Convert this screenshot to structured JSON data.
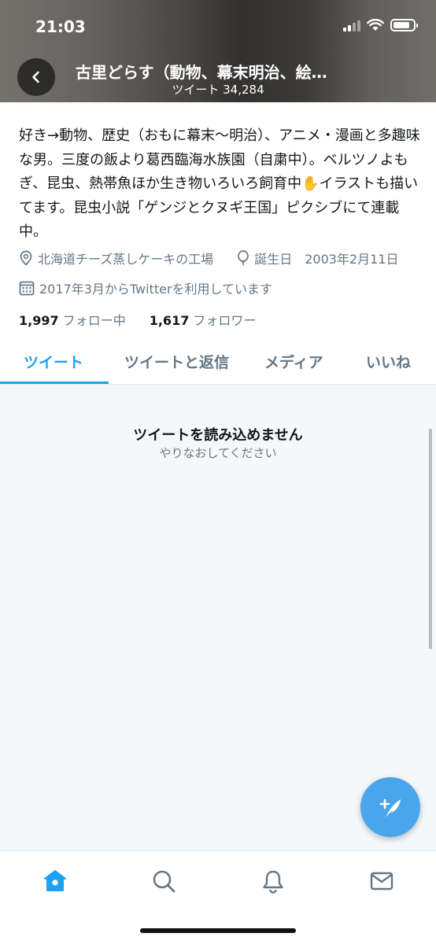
{
  "status_bar": {
    "time": "21:03",
    "battery_level": 0.85
  },
  "header": {
    "title": "古里どらす（動物、幕末明治、絵…",
    "subtitle": "ツイート 34,284"
  },
  "profile": {
    "bio": "好き→動物、歴史（おもに幕末〜明治）、アニメ・漫画と多趣味な男。三度の飯より葛西臨海水族園（自粛中）。ベルツノよもぎ、昆虫、熱帯魚ほか生き物いろいろ飼育中✋イラストも描いてます。昆虫小説「ゲンジとクヌギ王国」ピクシブにて連載中。",
    "location": "北海道チーズ蒸しケーキの工場",
    "birthday": "誕生日　2003年2月11日",
    "joined": "2017年3月からTwitterを利用しています",
    "following_count": "1,997",
    "following_label": "フォロー中",
    "followers_count": "1,617",
    "followers_label": "フォロワー"
  },
  "tabs": [
    {
      "label": "ツイート",
      "active": true
    },
    {
      "label": "ツイートと返信",
      "active": false
    },
    {
      "label": "メディア",
      "active": false
    },
    {
      "label": "いいね",
      "active": false
    }
  ],
  "content": {
    "error_title": "ツイートを読み込めません",
    "error_subtitle": "やりなおしてください"
  },
  "bottom_nav": [
    "home-icon",
    "search-icon",
    "bell-icon",
    "mail-icon"
  ],
  "colors": {
    "accent": "#1da1f2",
    "fab": "#4aa6ec",
    "secondary_text": "#657786"
  }
}
